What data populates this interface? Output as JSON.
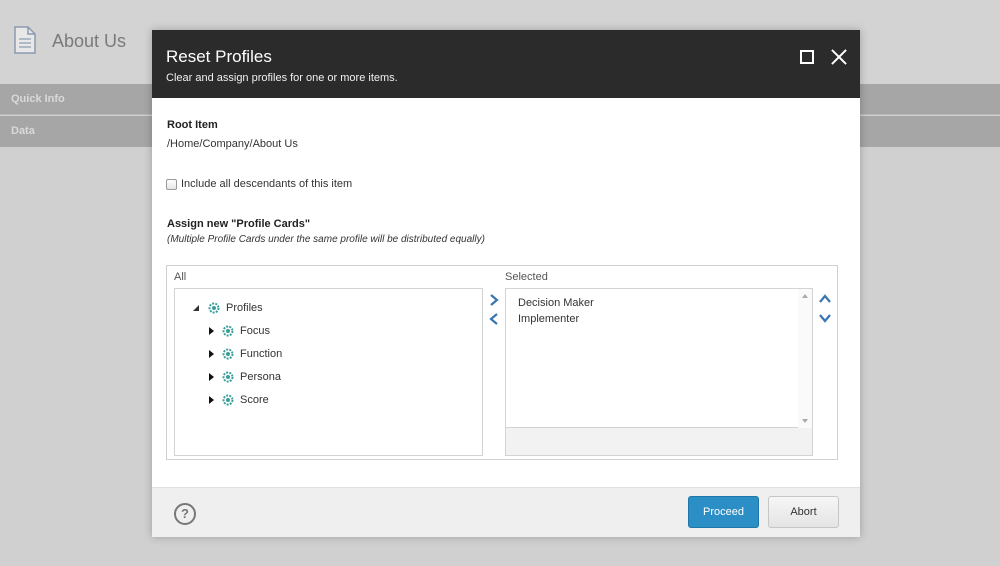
{
  "background": {
    "page_title": "About Us",
    "sections": [
      "Quick Info",
      "Data"
    ]
  },
  "dialog": {
    "title": "Reset Profiles",
    "subtitle": "Clear and assign profiles for one or more items.",
    "root_item_label": "Root Item",
    "root_item_path": "/Home/Company/About Us",
    "include_descendants_label": "Include all descendants of this item",
    "include_descendants_checked": false,
    "assign_label": "Assign new \"Profile Cards\"",
    "assign_note": "(Multiple Profile Cards under the same profile will be distributed equally)",
    "all_caption": "All",
    "selected_caption": "Selected",
    "tree": {
      "root": "Profiles",
      "children": [
        "Focus",
        "Function",
        "Persona",
        "Score"
      ]
    },
    "selected_items": [
      "Decision Maker",
      "Implementer"
    ],
    "buttons": {
      "proceed": "Proceed",
      "abort": "Abort",
      "help": "?"
    }
  },
  "colors": {
    "header_bg": "#2b2b2b",
    "proceed_bg": "#2b8fc5",
    "arrow_blue": "#3a75b0",
    "profile_icon": "#3a9d9a"
  },
  "icons": {
    "page": "document-icon",
    "profile": "profile-gear-icon",
    "move_right": "chevron-right-icon",
    "move_left": "chevron-left-icon",
    "up": "chevron-up-icon",
    "down": "chevron-down-icon"
  }
}
